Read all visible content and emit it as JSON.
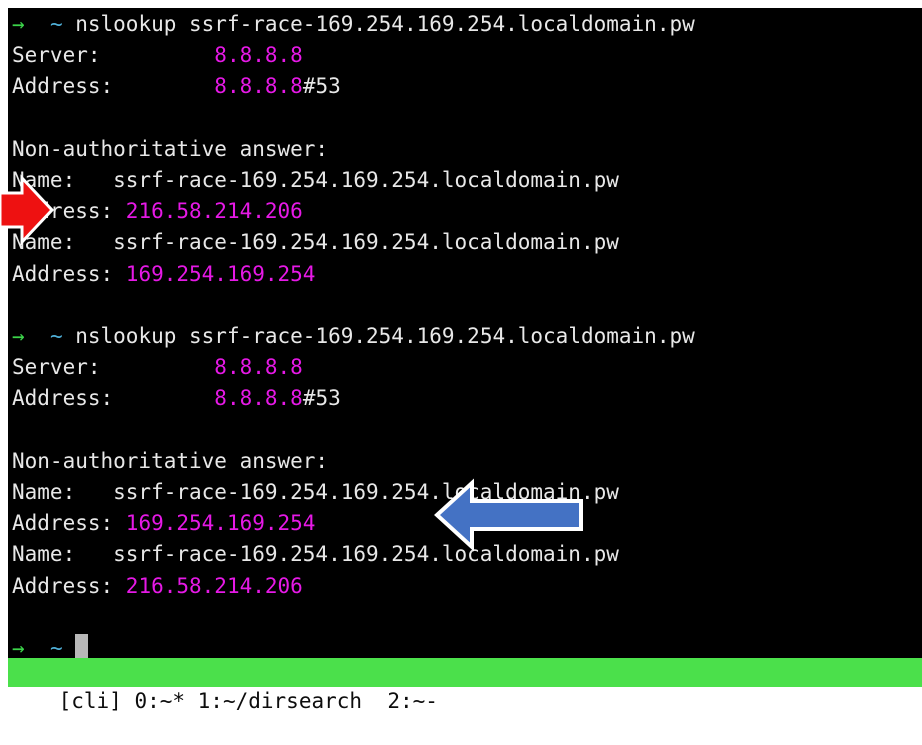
{
  "terminal": {
    "prompt_arrow": "→",
    "prompt_tilde": "~",
    "lines": [
      {
        "kind": "prompt",
        "command": "nslookup ssrf-race-169.254.169.254.localdomain.pw"
      },
      {
        "kind": "kv",
        "key": "Server:         ",
        "value": "8.8.8.8",
        "suffix": ""
      },
      {
        "kind": "kv",
        "key": "Address:        ",
        "value": "8.8.8.8",
        "suffix": "#53"
      },
      {
        "kind": "blank"
      },
      {
        "kind": "text",
        "text": "Non-authoritative answer:"
      },
      {
        "kind": "text",
        "text": "Name:   ssrf-race-169.254.169.254.localdomain.pw"
      },
      {
        "kind": "kv",
        "key": "Address: ",
        "value": "216.58.214.206",
        "suffix": ""
      },
      {
        "kind": "text",
        "text": "Name:   ssrf-race-169.254.169.254.localdomain.pw"
      },
      {
        "kind": "kv",
        "key": "Address: ",
        "value": "169.254.169.254",
        "suffix": ""
      },
      {
        "kind": "blank"
      },
      {
        "kind": "prompt",
        "command": "nslookup ssrf-race-169.254.169.254.localdomain.pw"
      },
      {
        "kind": "kv",
        "key": "Server:         ",
        "value": "8.8.8.8",
        "suffix": ""
      },
      {
        "kind": "kv",
        "key": "Address:        ",
        "value": "8.8.8.8",
        "suffix": "#53"
      },
      {
        "kind": "blank"
      },
      {
        "kind": "text",
        "text": "Non-authoritative answer:"
      },
      {
        "kind": "text",
        "text": "Name:   ssrf-race-169.254.169.254.localdomain.pw"
      },
      {
        "kind": "kv",
        "key": "Address: ",
        "value": "169.254.169.254",
        "suffix": ""
      },
      {
        "kind": "text",
        "text": "Name:   ssrf-race-169.254.169.254.localdomain.pw"
      },
      {
        "kind": "kv",
        "key": "Address: ",
        "value": "216.58.214.206",
        "suffix": ""
      },
      {
        "kind": "blank"
      },
      {
        "kind": "cursor"
      }
    ]
  },
  "statusbar": {
    "session": "[cli]",
    "windows": "0:~* 1:~/dirsearch  2:~-"
  },
  "annotations": {
    "red_arrow_color": "#ee1111",
    "blue_arrow_color": "#4472c4"
  },
  "colors": {
    "background": "#000000",
    "text": "#e8e8e8",
    "highlight": "#e619e6",
    "prompt_arrow": "#3cd44a",
    "status_bar": "#4be04b"
  }
}
